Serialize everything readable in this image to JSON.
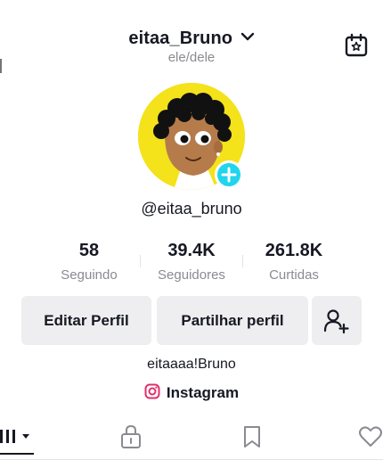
{
  "header": {
    "username": "eitaa_Bruno",
    "pronouns": "ele/dele",
    "calendar_icon": "calendar-star-icon"
  },
  "profile": {
    "handle": "@eitaa_bruno",
    "bio": "eitaaaa!Bruno",
    "link_label": "Instagram",
    "avatar_bg": "#f4e21b",
    "add_badge_color": "#20d5ec"
  },
  "stats": [
    {
      "value": "58",
      "label": "Seguindo"
    },
    {
      "value": "39.4K",
      "label": "Seguidores"
    },
    {
      "value": "261.8K",
      "label": "Curtidas"
    }
  ],
  "actions": {
    "edit_label": "Editar Perfil",
    "share_label": "Partilhar perfil",
    "add_friend_icon": "add-user-icon"
  },
  "tabs": [
    {
      "icon": "grid-icon",
      "active": true
    },
    {
      "icon": "lock-icon",
      "active": false
    },
    {
      "icon": "bookmark-icon",
      "active": false
    },
    {
      "icon": "heart-icon",
      "active": false
    }
  ],
  "colors": {
    "text_primary": "#161823",
    "text_secondary": "#8a8b91",
    "button_bg": "#eeeef0",
    "instagram": "#e1306c"
  }
}
